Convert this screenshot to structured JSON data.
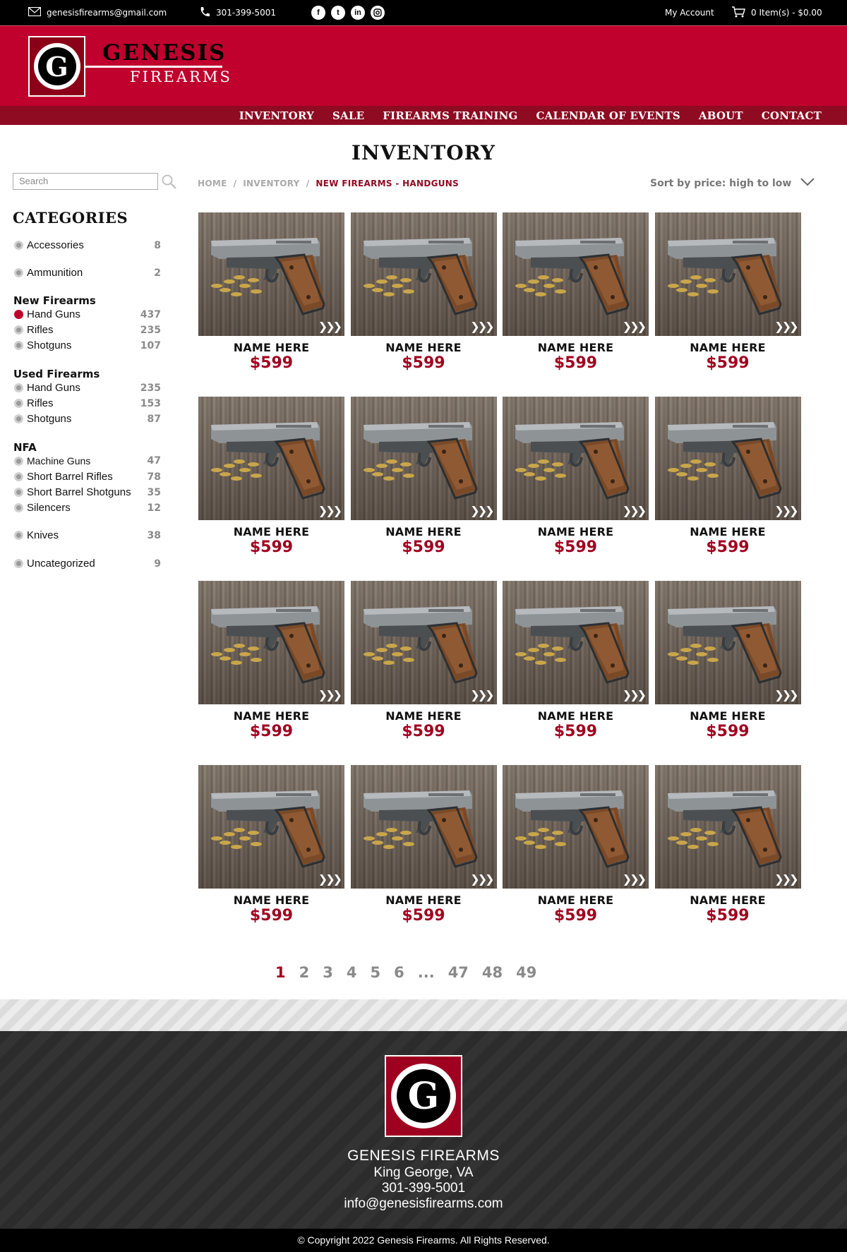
{
  "topbar": {
    "email": "genesisfirearms@gmail.com",
    "phone": "301-399-5001",
    "social_icons": [
      "facebook-icon",
      "twitter-icon",
      "linkedin-icon",
      "instagram-icon"
    ],
    "account": "My Account",
    "cart": "0 Item(s) - $0.00"
  },
  "brand": {
    "word1": "GENESIS",
    "word2": "FIREARMS",
    "mark": "G"
  },
  "nav": [
    "INVENTORY",
    "SALE",
    "FIREARMS TRAINING",
    "CALENDAR OF EVENTS",
    "ABOUT",
    "CONTACT"
  ],
  "page_title": "INVENTORY",
  "search": {
    "placeholder": "Search"
  },
  "categories": {
    "title": "CATEGORIES",
    "top": [
      {
        "label": "Accessories",
        "count": "8"
      },
      {
        "label": "Ammunition",
        "count": "2"
      }
    ],
    "new_firearms": {
      "title": "New Firearms",
      "items": [
        {
          "label": "Hand Guns",
          "count": "437",
          "active": true
        },
        {
          "label": "Rifles",
          "count": "235"
        },
        {
          "label": "Shotguns",
          "count": "107"
        }
      ]
    },
    "used_firearms": {
      "title": "Used Firearms",
      "items": [
        {
          "label": "Hand Guns",
          "count": "235"
        },
        {
          "label": "Rifles",
          "count": "153"
        },
        {
          "label": "Shotguns",
          "count": "87"
        }
      ]
    },
    "nfa": {
      "title": "NFA",
      "items": [
        {
          "label": "Machine Guns",
          "count": "47"
        },
        {
          "label": "Short Barrel Rifles",
          "count": "78"
        },
        {
          "label": "Short Barrel Shotguns",
          "count": "35"
        },
        {
          "label": "Silencers",
          "count": "12"
        }
      ]
    },
    "bottom": [
      {
        "label": "Knives",
        "count": "38"
      },
      {
        "label": "Uncategorized",
        "count": "9"
      }
    ]
  },
  "breadcrumb": {
    "home": "HOME",
    "sep": "/",
    "inventory": "INVENTORY",
    "current": "NEW FIREARMS - HANDGUNS"
  },
  "sort": {
    "label": "Sort by price: high to low"
  },
  "products": [
    {
      "name": "NAME HERE",
      "price": "$599"
    },
    {
      "name": "NAME HERE",
      "price": "$599"
    },
    {
      "name": "NAME HERE",
      "price": "$599"
    },
    {
      "name": "NAME HERE",
      "price": "$599"
    },
    {
      "name": "NAME HERE",
      "price": "$599"
    },
    {
      "name": "NAME HERE",
      "price": "$599"
    },
    {
      "name": "NAME HERE",
      "price": "$599"
    },
    {
      "name": "NAME HERE",
      "price": "$599"
    },
    {
      "name": "NAME HERE",
      "price": "$599"
    },
    {
      "name": "NAME HERE",
      "price": "$599"
    },
    {
      "name": "NAME HERE",
      "price": "$599"
    },
    {
      "name": "NAME HERE",
      "price": "$599"
    },
    {
      "name": "NAME HERE",
      "price": "$599"
    },
    {
      "name": "NAME HERE",
      "price": "$599"
    },
    {
      "name": "NAME HERE",
      "price": "$599"
    },
    {
      "name": "NAME HERE",
      "price": "$599"
    }
  ],
  "pagination": [
    "1",
    "2",
    "3",
    "4",
    "5",
    "6",
    "...",
    "47",
    "48",
    "49"
  ],
  "pagination_active": "1",
  "footer": {
    "name": "GENESIS FIREARMS",
    "city": "King George, VA",
    "phone": "301-399-5001",
    "email": "info@genesisfirearms.com",
    "copyright": "© Copyright 2022 Genesis Firearms. All Rights Reserved."
  },
  "colors": {
    "brand_red": "#c0002d",
    "dark_red": "#8e0b22",
    "price_red": "#a0001f",
    "topbar": "#000000"
  }
}
